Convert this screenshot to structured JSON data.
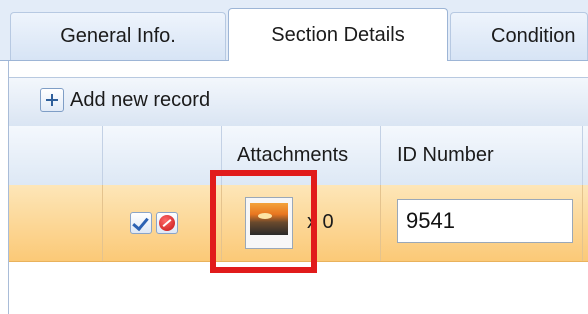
{
  "tabs": [
    {
      "label": "General Info.",
      "active": false
    },
    {
      "label": "Section Details",
      "active": true
    },
    {
      "label": "Condition",
      "active": false
    }
  ],
  "toolbar": {
    "add_label": "Add new record",
    "add_icon": "plus-icon"
  },
  "grid": {
    "headers": [
      "",
      "",
      "Attachments",
      "ID Number",
      ""
    ],
    "rows": [
      {
        "actions": {
          "confirm_icon": "check-icon",
          "cancel_icon": "cancel-icon"
        },
        "attachment": {
          "thumbnail_icon": "image-thumbnail-icon",
          "count_text": "x 0"
        },
        "id_number": "9541"
      }
    ]
  },
  "colors": {
    "selected_row": "#fbc977",
    "highlight_box": "#e11b1b",
    "tab_strip": "#e3ecf8"
  }
}
